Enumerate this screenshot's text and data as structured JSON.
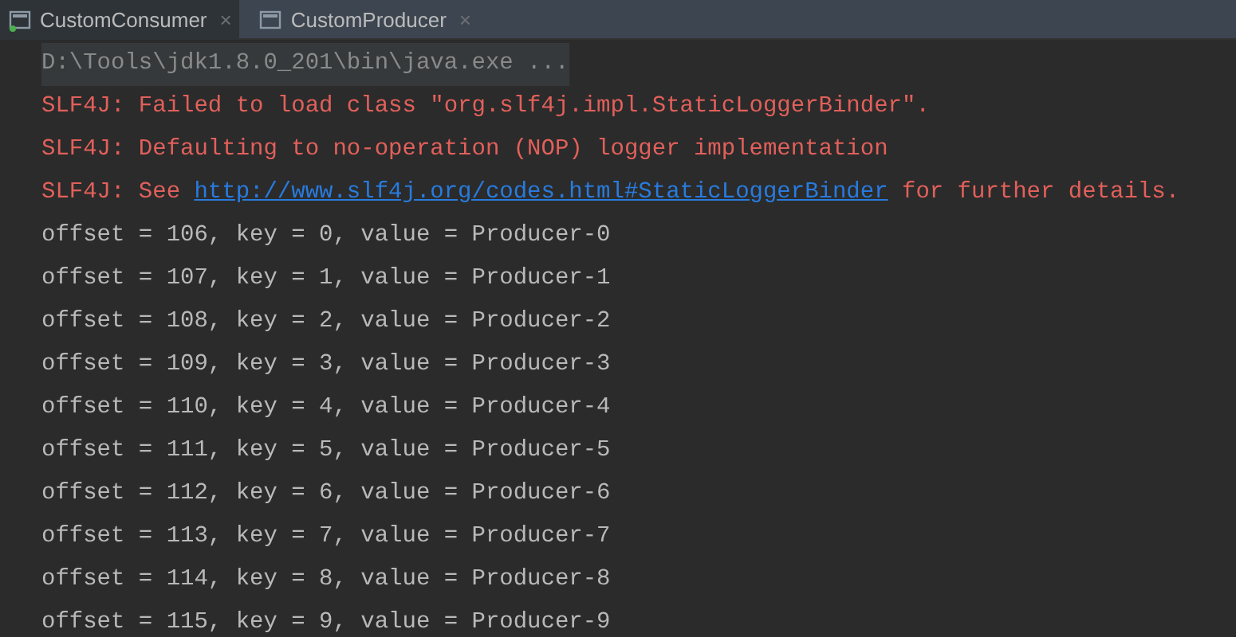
{
  "tabs": [
    {
      "label": "CustomConsumer",
      "selected": true,
      "running": true,
      "close": "×"
    },
    {
      "label": "CustomProducer",
      "selected": false,
      "running": false,
      "close": "×"
    }
  ],
  "console": [
    {
      "kind": "command",
      "text": "D:\\Tools\\jdk1.8.0_201\\bin\\java.exe ..."
    },
    {
      "kind": "error",
      "text": "SLF4J: Failed to load class \"org.slf4j.impl.StaticLoggerBinder\"."
    },
    {
      "kind": "error",
      "text": "SLF4J: Defaulting to no-operation (NOP) logger implementation"
    },
    {
      "kind": "error",
      "segments": [
        {
          "kind": "text",
          "text": "SLF4J: See "
        },
        {
          "kind": "link",
          "text": "http://www.slf4j.org/codes.html#StaticLoggerBinder"
        },
        {
          "kind": "text",
          "text": " for further details."
        }
      ]
    },
    {
      "kind": "output",
      "text": "offset = 106, key = 0, value = Producer-0"
    },
    {
      "kind": "output",
      "text": "offset = 107, key = 1, value = Producer-1"
    },
    {
      "kind": "output",
      "text": "offset = 108, key = 2, value = Producer-2"
    },
    {
      "kind": "output",
      "text": "offset = 109, key = 3, value = Producer-3"
    },
    {
      "kind": "output",
      "text": "offset = 110, key = 4, value = Producer-4"
    },
    {
      "kind": "output",
      "text": "offset = 111, key = 5, value = Producer-5"
    },
    {
      "kind": "output",
      "text": "offset = 112, key = 6, value = Producer-6"
    },
    {
      "kind": "output",
      "text": "offset = 113, key = 7, value = Producer-7"
    },
    {
      "kind": "output",
      "text": "offset = 114, key = 8, value = Producer-8"
    },
    {
      "kind": "output",
      "text": "offset = 115, key = 9, value = Producer-9"
    }
  ]
}
